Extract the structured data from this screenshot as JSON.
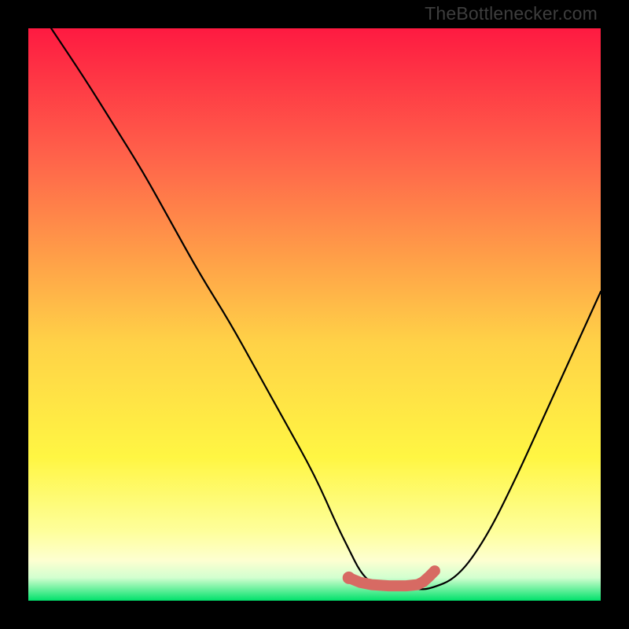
{
  "watermark": "TheBottlenecker.com",
  "colors": {
    "frame": "#000000",
    "curve": "#000000",
    "marker_fill": "#d76a63",
    "marker_stroke": "#d76a63",
    "gradient_top": "#fe1a41",
    "gradient_upper": "#ff614a",
    "gradient_mid": "#ffd247",
    "gradient_yellow": "#fff643",
    "gradient_pale": "#feff9c",
    "gradient_cream": "#fdffd1",
    "gradient_mint": "#d2ffcf",
    "gradient_green": "#00e16b"
  },
  "chart_data": {
    "type": "line",
    "title": "",
    "xlabel": "",
    "ylabel": "",
    "xlim": [
      0,
      100
    ],
    "ylim": [
      0,
      100
    ],
    "series": [
      {
        "name": "bottleneck-curve",
        "x_pct": [
          4,
          10,
          15,
          20,
          25,
          30,
          35,
          40,
          45,
          50,
          54,
          56,
          58,
          60,
          64,
          68,
          70,
          75,
          80,
          85,
          90,
          95,
          100
        ],
        "y_pct": [
          100,
          91,
          83,
          75,
          66,
          57,
          49,
          40,
          31,
          22,
          13,
          9,
          5,
          3,
          2,
          2,
          2,
          4,
          11,
          21,
          32,
          43,
          54
        ]
      }
    ],
    "markers": {
      "name": "highlight-segment",
      "x_pct": [
        56,
        58,
        60,
        63,
        66,
        68,
        69,
        70,
        71
      ],
      "y_pct": [
        4.0,
        3.2,
        2.8,
        2.6,
        2.6,
        2.8,
        3.3,
        4.2,
        5.2
      ]
    },
    "annotations": [
      {
        "text": "TheBottlenecker.com",
        "position": "top-right"
      }
    ]
  }
}
